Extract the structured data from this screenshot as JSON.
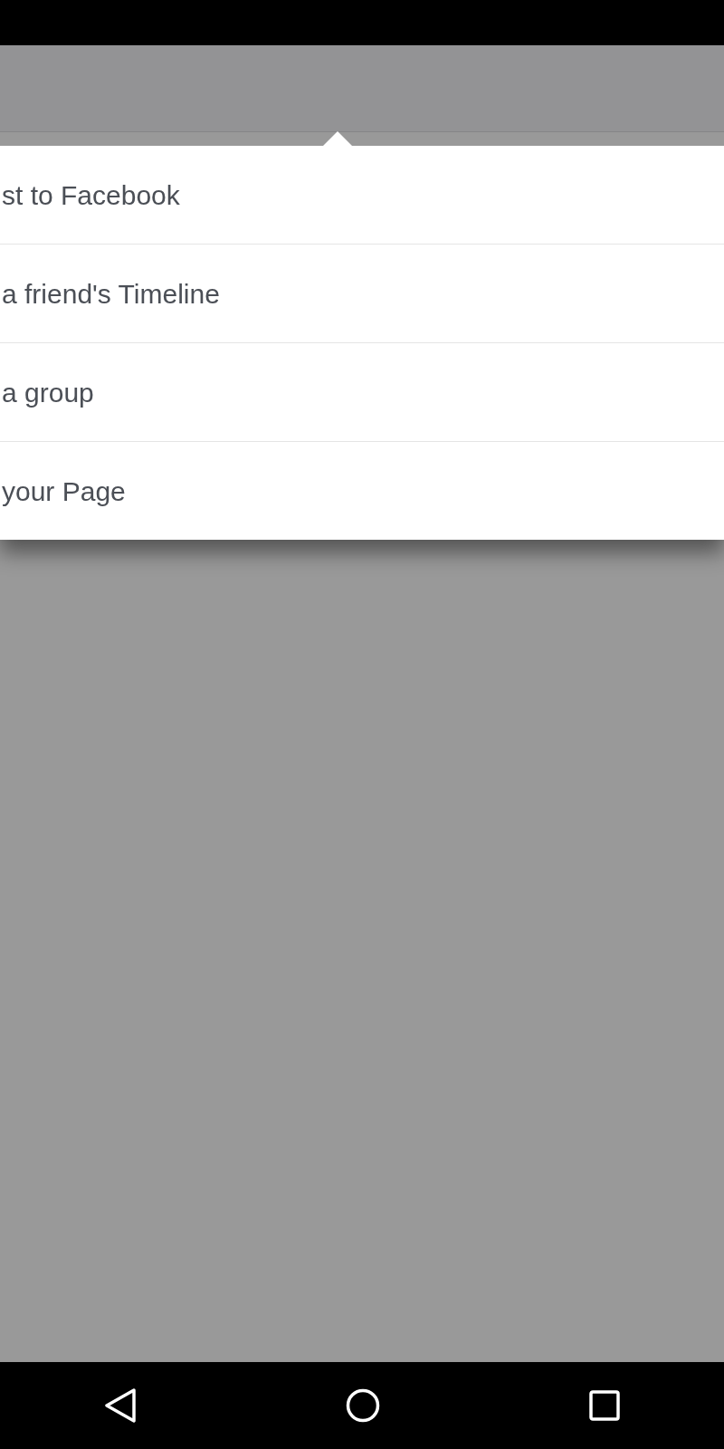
{
  "menu": {
    "items": [
      {
        "label": "st to Facebook"
      },
      {
        "label": "a friend's Timeline"
      },
      {
        "label": "a group"
      },
      {
        "label": "your Page"
      }
    ]
  }
}
